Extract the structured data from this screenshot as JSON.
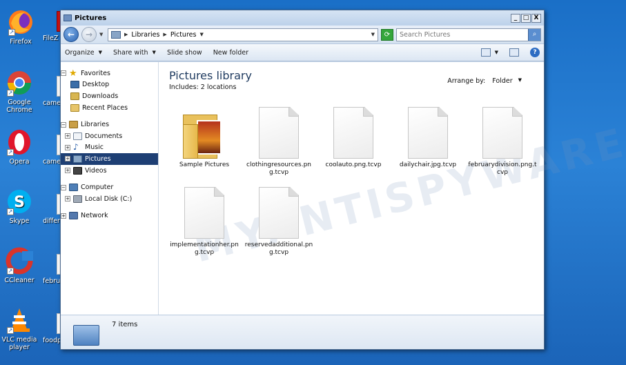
{
  "desktop": {
    "icons": [
      {
        "label": "Firefox"
      },
      {
        "label": "Google Chrome"
      },
      {
        "label": "Opera"
      },
      {
        "label": "Skype"
      },
      {
        "label": "CCleaner"
      },
      {
        "label": "VLC media player"
      }
    ],
    "second_column": [
      "FileZ",
      "came",
      "came",
      "differ",
      "febru",
      "foodp"
    ]
  },
  "window": {
    "title": "Pictures",
    "controls": {
      "minimize": "_",
      "maximize": "□",
      "close": "X"
    }
  },
  "address": {
    "crumbs": [
      "Libraries",
      "Pictures"
    ],
    "search_placeholder": "Search Pictures"
  },
  "toolbar": {
    "organize": "Organize",
    "share_with": "Share with",
    "slide_show": "Slide show",
    "new_folder": "New folder"
  },
  "nav": {
    "favorites": "Favorites",
    "desktop": "Desktop",
    "downloads": "Downloads",
    "recent": "Recent Places",
    "libraries": "Libraries",
    "documents": "Documents",
    "music": "Music",
    "pictures": "Pictures",
    "videos": "Videos",
    "computer": "Computer",
    "local_disk": "Local Disk (C:)",
    "network": "Network"
  },
  "library": {
    "title": "Pictures library",
    "includes": "Includes:  2 locations",
    "arrange_label": "Arrange by:",
    "arrange_value": "Folder"
  },
  "files": [
    {
      "name": "Sample Pictures",
      "kind": "folder"
    },
    {
      "name": "clothingresources.png.tcvp",
      "kind": "file"
    },
    {
      "name": "coolauto.png.tcvp",
      "kind": "file"
    },
    {
      "name": "dailychair.jpg.tcvp",
      "kind": "file"
    },
    {
      "name": "februarydivision.png.tcvp",
      "kind": "file"
    },
    {
      "name": "implementationher.png.tcvp",
      "kind": "file"
    },
    {
      "name": "reservedadditional.png.tcvp",
      "kind": "file"
    }
  ],
  "details": {
    "item_count": "7 items"
  },
  "watermark": "MYANTISPYWARE.COM"
}
